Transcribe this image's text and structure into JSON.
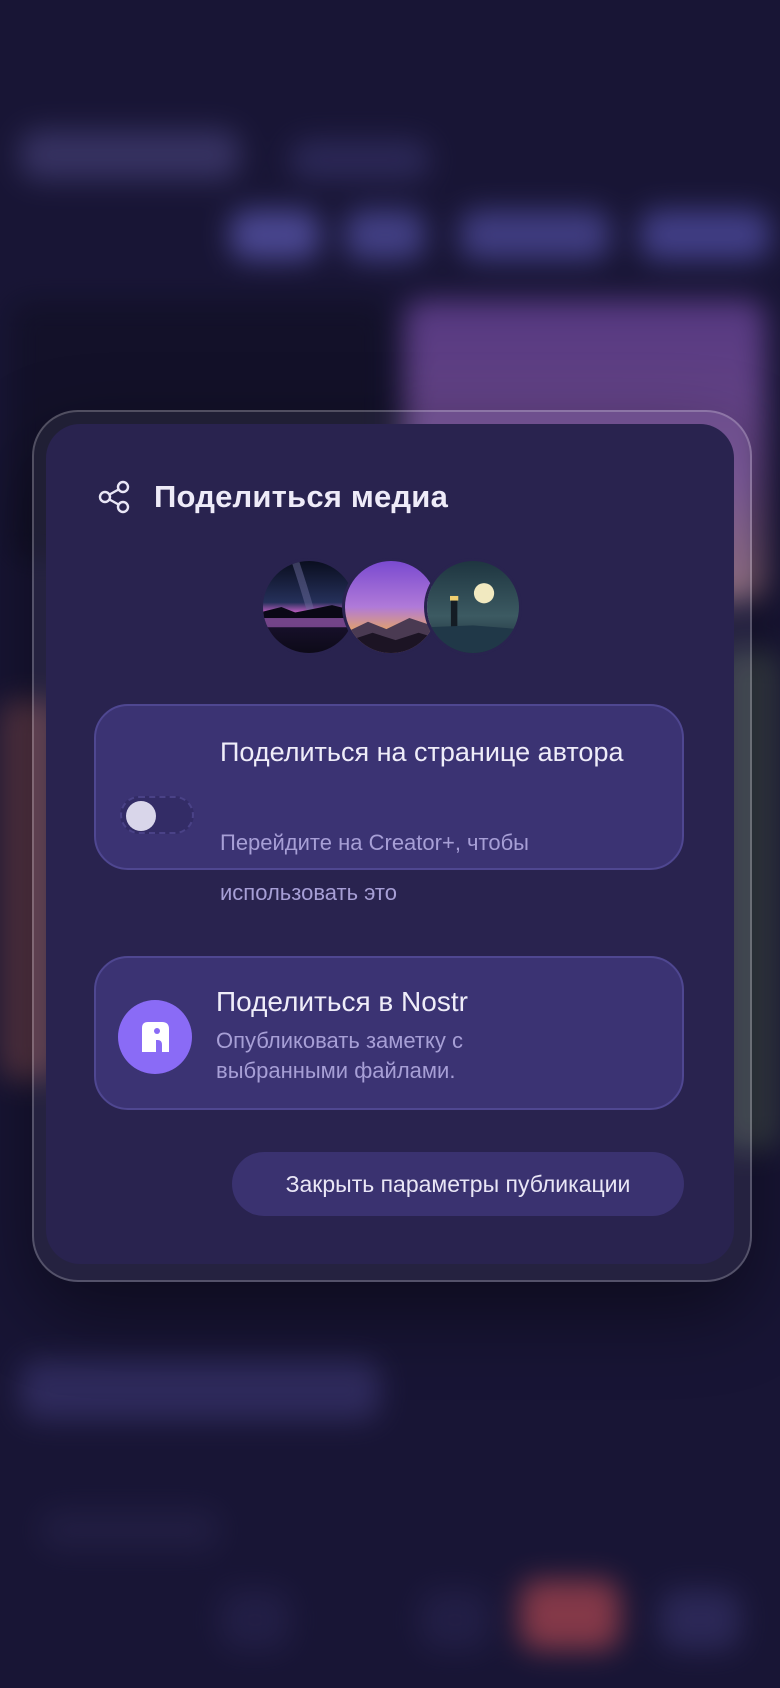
{
  "modal": {
    "title": "Поделиться медиа",
    "title_icon": "share-icon",
    "selected_media": [
      {
        "name": "night-lake-thumbnail"
      },
      {
        "name": "purple-sunset-mountains-thumbnail"
      },
      {
        "name": "lighthouse-moon-thumbnail"
      }
    ],
    "author_page": {
      "title": "Поделиться на странице автора",
      "description": "Перейдите на Creator+, чтобы использовать это",
      "toggle_enabled": false
    },
    "nostr": {
      "title": "Поделиться в Nostr",
      "description": "Опубликовать заметку с выбранными файлами.",
      "icon": "nostr-logo-icon"
    },
    "close_button_label": "Закрыть параметры публикации"
  },
  "colors": {
    "modal_background": "#29234f",
    "card_background": "#3b3373",
    "accent": "#8a6bf6",
    "secondary_text": "#a79fd6"
  }
}
